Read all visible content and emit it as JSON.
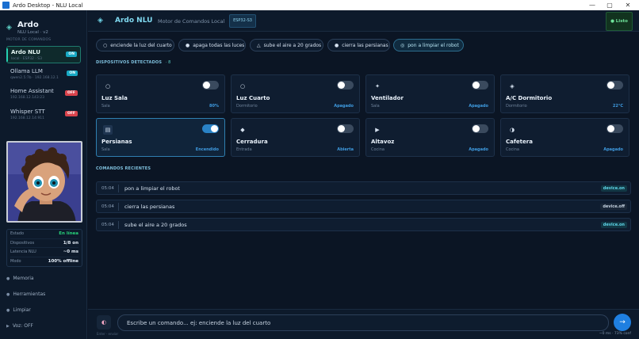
{
  "window": {
    "title": "Ardo Desktop - NLU Local",
    "controls": [
      "—",
      "▢",
      "✕"
    ]
  },
  "brand": {
    "name": "Ardo",
    "subtitle": "NLU Local · v2"
  },
  "sidebar": {
    "section_label": "MOTOR DE COMANDOS",
    "models": [
      {
        "name": "Ardo NLU",
        "addr": "local · ESP32 · S3",
        "status": "ON",
        "active": true
      },
      {
        "name": "Ollama LLM",
        "addr": "qwen2.5:7b · 192.168.12.1",
        "status": "ON",
        "active": false
      },
      {
        "name": "Home Assistant",
        "addr": "192.168.12.143:23",
        "status": "OFF",
        "active": false
      },
      {
        "name": "Whisper STT",
        "addr": "192.168.12.14:911",
        "status": "OFF",
        "active": false
      }
    ],
    "stats": [
      {
        "label": "Estado",
        "value": "En línea",
        "accent": "green"
      },
      {
        "label": "Dispositivos",
        "value": "1/8 on",
        "accent": ""
      },
      {
        "label": "Latencia NLU",
        "value": "~0 ms",
        "accent": ""
      },
      {
        "label": "Modo",
        "value": "100% offline",
        "accent": ""
      }
    ],
    "actions": [
      {
        "icon": "●",
        "label": "Memoria"
      },
      {
        "icon": "●",
        "label": "Herramientas"
      },
      {
        "icon": "●",
        "label": "Limpiar"
      },
      {
        "icon": "▶",
        "label": "Voz: OFF"
      }
    ]
  },
  "header": {
    "title": "Ardo NLU",
    "subtitle": "Motor de Comandos Local",
    "chip": "ESP32-S3",
    "status": "● Listo"
  },
  "quick_commands": [
    {
      "icon": "○",
      "label": "enciende la luz del cuarto"
    },
    {
      "icon": "●",
      "label": "apaga todas las luces"
    },
    {
      "icon": "△",
      "label": "sube el aire a 20 grados"
    },
    {
      "icon": "●",
      "label": "cierra las persianas"
    },
    {
      "icon": "◎",
      "label": "pon a limpiar el robot"
    }
  ],
  "devices_section": {
    "label": "DISPOSITIVOS DETECTADOS",
    "count": "· 8"
  },
  "devices": [
    {
      "icon": "○",
      "name": "Luz Sala",
      "room": "Sala",
      "state": "80%",
      "on": false
    },
    {
      "icon": "○",
      "name": "Luz Cuarto",
      "room": "Dormitorio",
      "state": "Apagado",
      "on": false
    },
    {
      "icon": "✦",
      "name": "Ventilador",
      "room": "Sala",
      "state": "Apagado",
      "on": false
    },
    {
      "icon": "◈",
      "name": "A/C Dormitorio",
      "room": "Dormitorio",
      "state": "22°C",
      "on": false
    },
    {
      "icon": "▤",
      "name": "Persianas",
      "room": "Sala",
      "state": "Encendido",
      "on": true
    },
    {
      "icon": "◆",
      "name": "Cerradura",
      "room": "Entrada",
      "state": "Abierta",
      "on": false
    },
    {
      "icon": "▶",
      "name": "Altavoz",
      "room": "Cocina",
      "state": "Apagado",
      "on": false
    },
    {
      "icon": "◑",
      "name": "Cafetera",
      "room": "Cocina",
      "state": "Apagado",
      "on": false
    }
  ],
  "recent": {
    "label": "COMANDOS RECIENTES",
    "items": [
      {
        "time": "05:04",
        "command": "pon a limpiar el robot",
        "tag": "device.on",
        "kind": "on"
      },
      {
        "time": "05:04",
        "command": "cierra las persianas",
        "tag": "device.off",
        "kind": "off"
      },
      {
        "time": "05:04",
        "command": "sube el aire a 20 grados",
        "tag": "device.on",
        "kind": "on"
      }
    ]
  },
  "input": {
    "placeholder": "Escribe un comando... ej: enciende la luz del cuarto",
    "hint": "Enter · enviar",
    "meta": "~0 ms · 73% conf",
    "mic_icon": "◐",
    "send_icon": "→"
  },
  "colors": {
    "accent": "#25d0b0",
    "primary": "#2a83c6",
    "off": "#d9434c",
    "online": "#27d37a"
  }
}
